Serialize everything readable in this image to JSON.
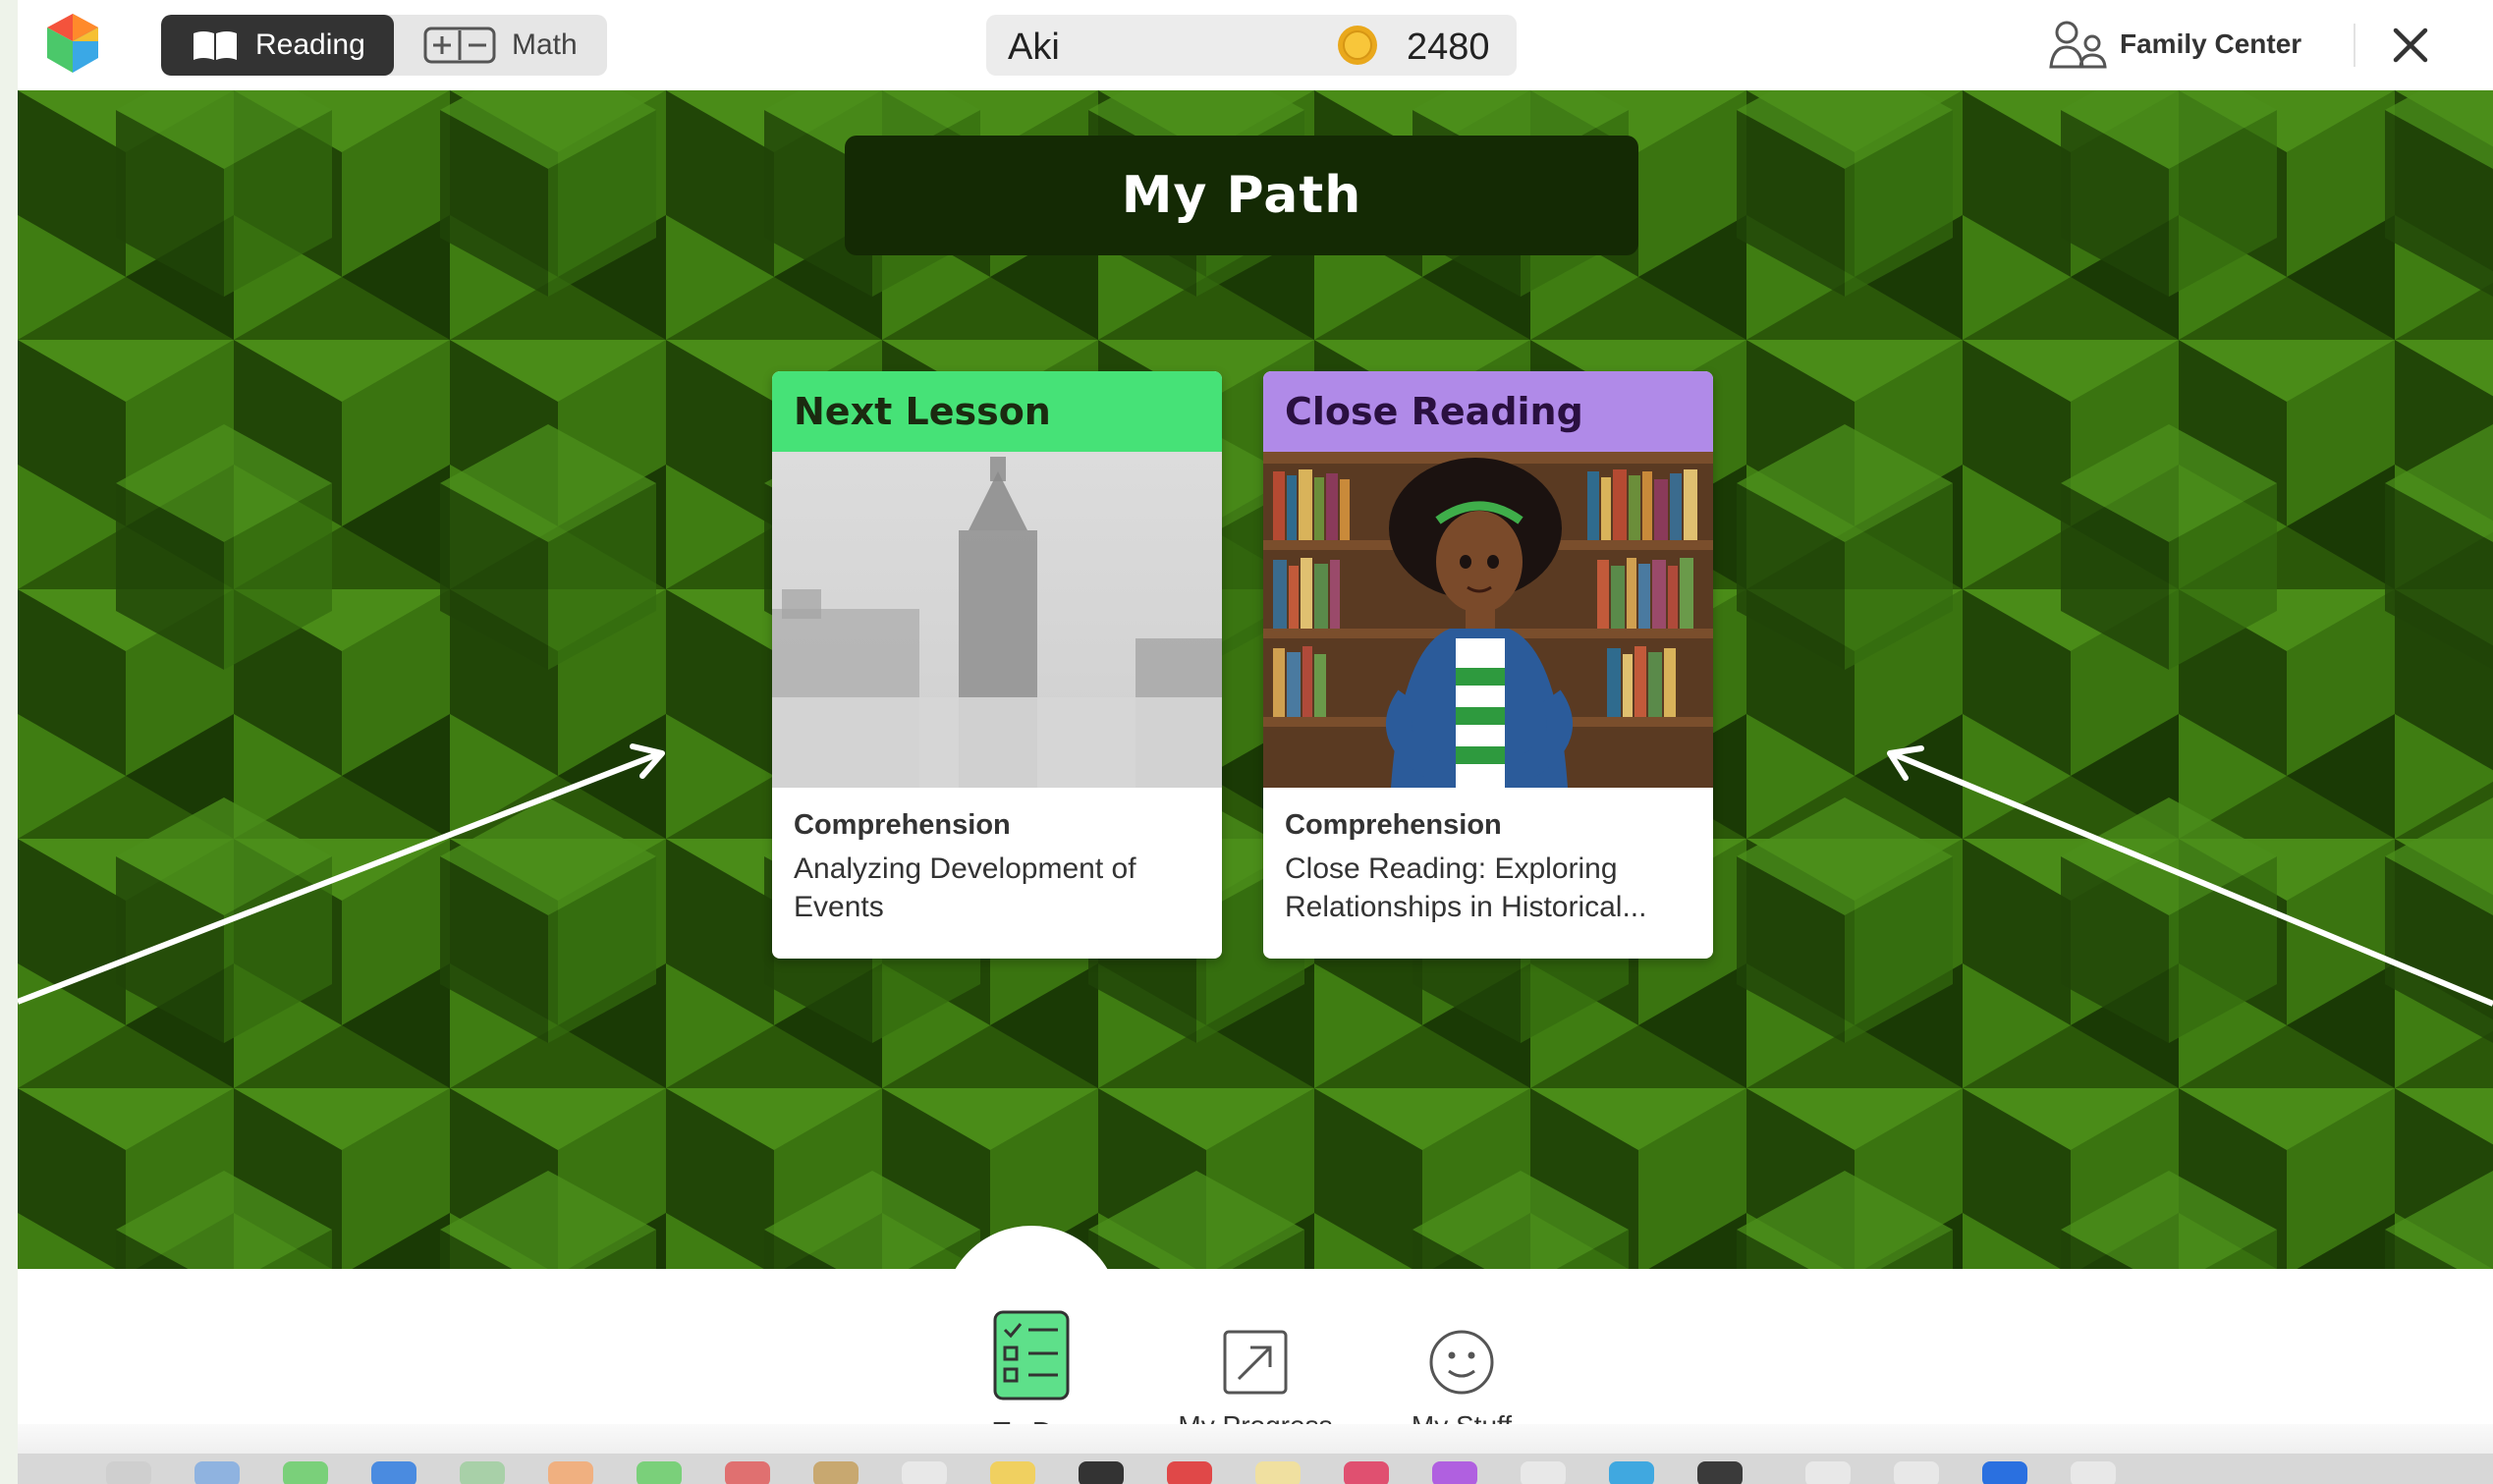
{
  "header": {
    "subjects": [
      {
        "label": "Reading",
        "active": true
      },
      {
        "label": "Math",
        "active": false
      }
    ],
    "player_name": "Aki",
    "coins": "2480",
    "family_center_label": "Family Center"
  },
  "main": {
    "title": "My Path",
    "cards": [
      {
        "header": "Next Lesson",
        "header_color": "#46e277",
        "category": "Comprehension",
        "description": "Analyzing Development of Events"
      },
      {
        "header": "Close Reading",
        "header_color": "#b08ae8",
        "category": "Comprehension",
        "description": "Close Reading: Exploring Relationships in Historical..."
      }
    ]
  },
  "bottom_nav": {
    "items": [
      {
        "label": "To Do",
        "active": true
      },
      {
        "label": "My Progress",
        "active": false
      },
      {
        "label": "My Stuff",
        "active": false
      }
    ]
  },
  "colors": {
    "background_green": "#2c5a0a",
    "title_bar": "#142a04",
    "accent_green": "#46e277",
    "accent_purple": "#b08ae8"
  }
}
